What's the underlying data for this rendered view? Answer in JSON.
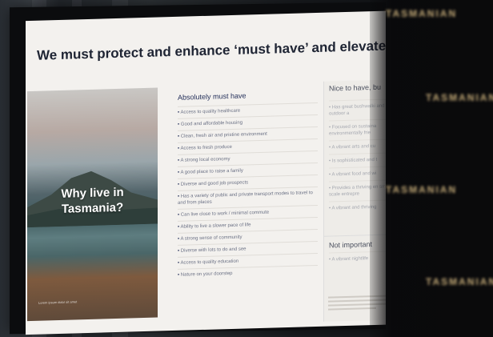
{
  "slide": {
    "title": "We must protect and enhance ‘must have’ and elevate ‘nice t",
    "photo_heading_line1": "Why live in",
    "photo_heading_line2": "Tasmania?",
    "photo_caption": "Lorem ipsum dolor sit amet",
    "must_have": {
      "heading": "Absolutely must have",
      "items": [
        "Access to quality healthcare",
        "Good and affordable housing",
        "Clean, fresh air and pristine environment",
        "Access to fresh produce",
        "A strong local economy",
        "A good place to raise a family",
        "Diverse and good job prospects",
        "Has a variety of public and private transport modes to travel to and from places",
        "Can live close to work / minimal commute",
        "Ability to live a slower pace of life",
        "A strong sense of community",
        "Diverse with lots to do and see",
        "Access to quality education",
        "Nature on your doorstep"
      ]
    },
    "nice_to_have": {
      "heading": "Nice to have, bu",
      "items": [
        "Has great bushwalki and other outdoor a",
        "Focused on sustaina environmentally frie",
        "A vibrant arts and cu",
        "Is sophisticated and t",
        "A vibrant food and wi",
        "Provides a thriving en small-scale entrepre",
        "A vibrant and thriving"
      ]
    },
    "not_important": {
      "heading": "Not important",
      "items": [
        "A vibrant nightlife"
      ]
    },
    "brand": "TASMANIAN"
  },
  "bokeh_text": "TASMANIAN"
}
